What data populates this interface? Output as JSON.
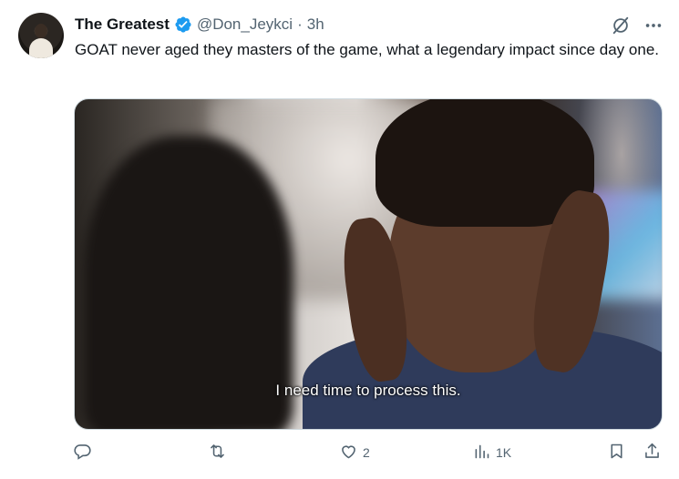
{
  "tweet": {
    "author_name": "The Greatest",
    "handle": "@Don_Jeykci",
    "separator": "·",
    "time": "3h",
    "text": "GOAT never aged they masters of the game, what a legendary impact since day one.",
    "media": {
      "caption": "I need time to process this."
    }
  },
  "actions": {
    "replies": "",
    "reposts": "",
    "likes": "2",
    "views": "1K"
  },
  "icons": {
    "verified": "verified-badge-icon",
    "grok": "grok-icon",
    "more": "more-icon",
    "reply": "reply-icon",
    "repost": "repost-icon",
    "like": "heart-icon",
    "views": "views-icon",
    "bookmark": "bookmark-icon",
    "share": "share-icon"
  },
  "colors": {
    "verified": "#1d9bf0",
    "muted": "#536471",
    "text": "#0f1419"
  }
}
